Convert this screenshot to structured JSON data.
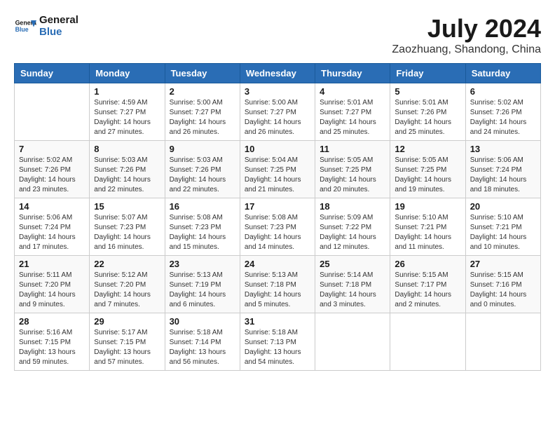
{
  "logo": {
    "line1": "General",
    "line2": "Blue"
  },
  "title": "July 2024",
  "location": "Zaozhuang, Shandong, China",
  "days_of_week": [
    "Sunday",
    "Monday",
    "Tuesday",
    "Wednesday",
    "Thursday",
    "Friday",
    "Saturday"
  ],
  "weeks": [
    [
      {
        "day": "",
        "info": ""
      },
      {
        "day": "1",
        "info": "Sunrise: 4:59 AM\nSunset: 7:27 PM\nDaylight: 14 hours\nand 27 minutes."
      },
      {
        "day": "2",
        "info": "Sunrise: 5:00 AM\nSunset: 7:27 PM\nDaylight: 14 hours\nand 26 minutes."
      },
      {
        "day": "3",
        "info": "Sunrise: 5:00 AM\nSunset: 7:27 PM\nDaylight: 14 hours\nand 26 minutes."
      },
      {
        "day": "4",
        "info": "Sunrise: 5:01 AM\nSunset: 7:27 PM\nDaylight: 14 hours\nand 25 minutes."
      },
      {
        "day": "5",
        "info": "Sunrise: 5:01 AM\nSunset: 7:26 PM\nDaylight: 14 hours\nand 25 minutes."
      },
      {
        "day": "6",
        "info": "Sunrise: 5:02 AM\nSunset: 7:26 PM\nDaylight: 14 hours\nand 24 minutes."
      }
    ],
    [
      {
        "day": "7",
        "info": "Sunrise: 5:02 AM\nSunset: 7:26 PM\nDaylight: 14 hours\nand 23 minutes."
      },
      {
        "day": "8",
        "info": "Sunrise: 5:03 AM\nSunset: 7:26 PM\nDaylight: 14 hours\nand 22 minutes."
      },
      {
        "day": "9",
        "info": "Sunrise: 5:03 AM\nSunset: 7:26 PM\nDaylight: 14 hours\nand 22 minutes."
      },
      {
        "day": "10",
        "info": "Sunrise: 5:04 AM\nSunset: 7:25 PM\nDaylight: 14 hours\nand 21 minutes."
      },
      {
        "day": "11",
        "info": "Sunrise: 5:05 AM\nSunset: 7:25 PM\nDaylight: 14 hours\nand 20 minutes."
      },
      {
        "day": "12",
        "info": "Sunrise: 5:05 AM\nSunset: 7:25 PM\nDaylight: 14 hours\nand 19 minutes."
      },
      {
        "day": "13",
        "info": "Sunrise: 5:06 AM\nSunset: 7:24 PM\nDaylight: 14 hours\nand 18 minutes."
      }
    ],
    [
      {
        "day": "14",
        "info": "Sunrise: 5:06 AM\nSunset: 7:24 PM\nDaylight: 14 hours\nand 17 minutes."
      },
      {
        "day": "15",
        "info": "Sunrise: 5:07 AM\nSunset: 7:23 PM\nDaylight: 14 hours\nand 16 minutes."
      },
      {
        "day": "16",
        "info": "Sunrise: 5:08 AM\nSunset: 7:23 PM\nDaylight: 14 hours\nand 15 minutes."
      },
      {
        "day": "17",
        "info": "Sunrise: 5:08 AM\nSunset: 7:23 PM\nDaylight: 14 hours\nand 14 minutes."
      },
      {
        "day": "18",
        "info": "Sunrise: 5:09 AM\nSunset: 7:22 PM\nDaylight: 14 hours\nand 12 minutes."
      },
      {
        "day": "19",
        "info": "Sunrise: 5:10 AM\nSunset: 7:21 PM\nDaylight: 14 hours\nand 11 minutes."
      },
      {
        "day": "20",
        "info": "Sunrise: 5:10 AM\nSunset: 7:21 PM\nDaylight: 14 hours\nand 10 minutes."
      }
    ],
    [
      {
        "day": "21",
        "info": "Sunrise: 5:11 AM\nSunset: 7:20 PM\nDaylight: 14 hours\nand 9 minutes."
      },
      {
        "day": "22",
        "info": "Sunrise: 5:12 AM\nSunset: 7:20 PM\nDaylight: 14 hours\nand 7 minutes."
      },
      {
        "day": "23",
        "info": "Sunrise: 5:13 AM\nSunset: 7:19 PM\nDaylight: 14 hours\nand 6 minutes."
      },
      {
        "day": "24",
        "info": "Sunrise: 5:13 AM\nSunset: 7:18 PM\nDaylight: 14 hours\nand 5 minutes."
      },
      {
        "day": "25",
        "info": "Sunrise: 5:14 AM\nSunset: 7:18 PM\nDaylight: 14 hours\nand 3 minutes."
      },
      {
        "day": "26",
        "info": "Sunrise: 5:15 AM\nSunset: 7:17 PM\nDaylight: 14 hours\nand 2 minutes."
      },
      {
        "day": "27",
        "info": "Sunrise: 5:15 AM\nSunset: 7:16 PM\nDaylight: 14 hours\nand 0 minutes."
      }
    ],
    [
      {
        "day": "28",
        "info": "Sunrise: 5:16 AM\nSunset: 7:15 PM\nDaylight: 13 hours\nand 59 minutes."
      },
      {
        "day": "29",
        "info": "Sunrise: 5:17 AM\nSunset: 7:15 PM\nDaylight: 13 hours\nand 57 minutes."
      },
      {
        "day": "30",
        "info": "Sunrise: 5:18 AM\nSunset: 7:14 PM\nDaylight: 13 hours\nand 56 minutes."
      },
      {
        "day": "31",
        "info": "Sunrise: 5:18 AM\nSunset: 7:13 PM\nDaylight: 13 hours\nand 54 minutes."
      },
      {
        "day": "",
        "info": ""
      },
      {
        "day": "",
        "info": ""
      },
      {
        "day": "",
        "info": ""
      }
    ]
  ]
}
